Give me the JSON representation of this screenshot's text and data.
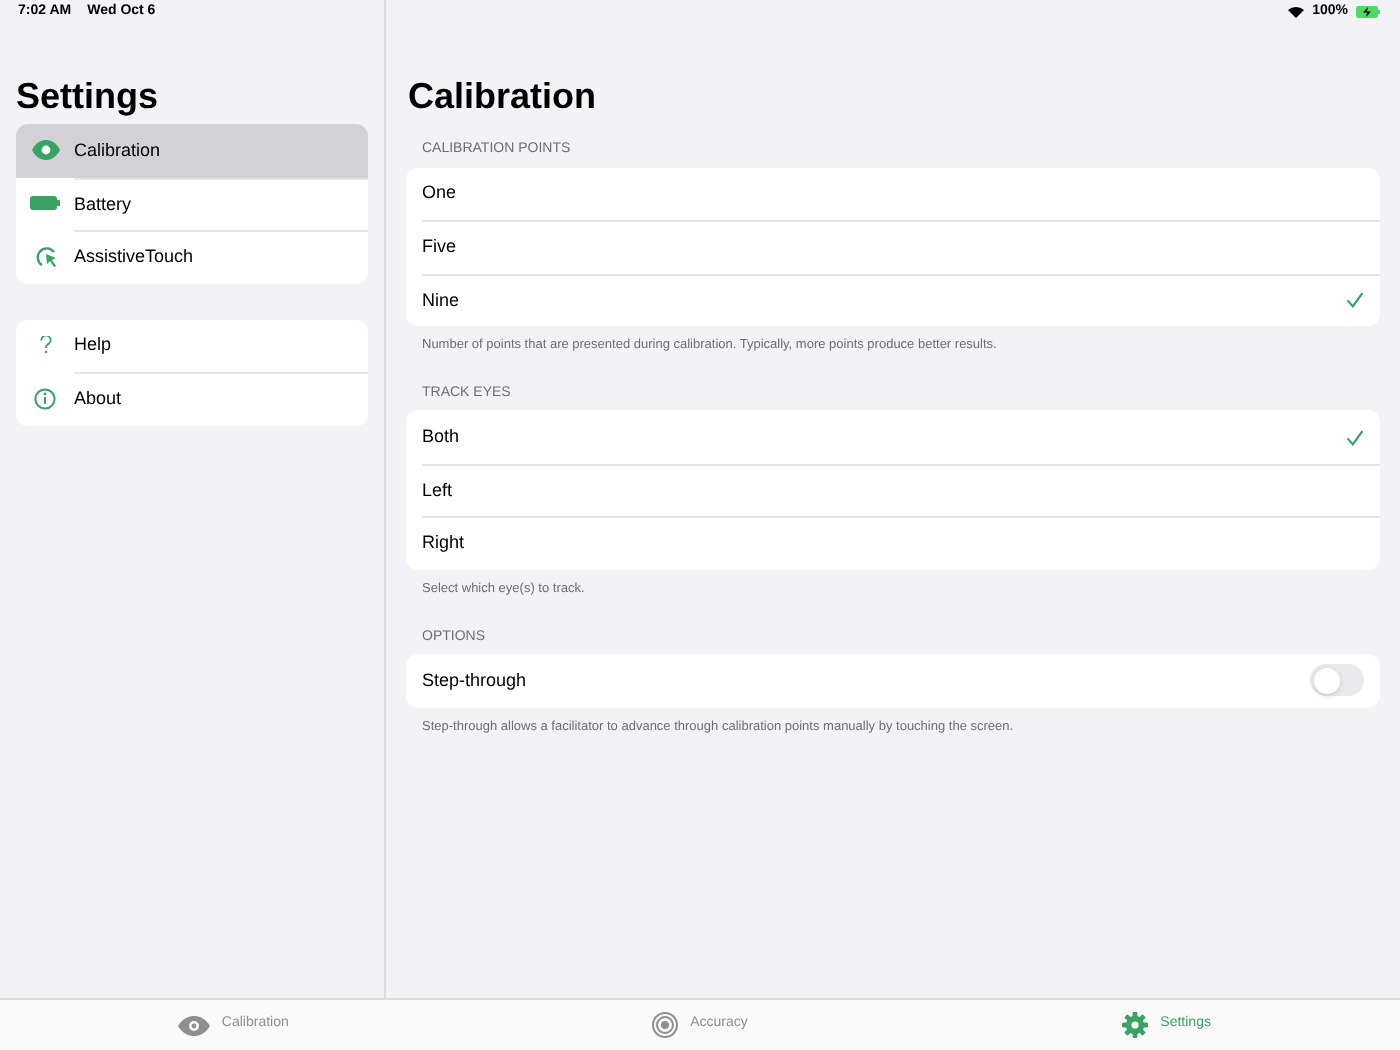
{
  "status_bar": {
    "time": "7:02 AM",
    "date": "Wed Oct 6",
    "battery": "100%"
  },
  "sidebar": {
    "title": "Settings",
    "groups": [
      {
        "items": [
          {
            "label": "Calibration",
            "selected": true
          },
          {
            "label": "Battery",
            "selected": false
          },
          {
            "label": "AssistiveTouch",
            "selected": false
          }
        ]
      },
      {
        "items": [
          {
            "label": "Help",
            "selected": false
          },
          {
            "label": "About",
            "selected": false
          }
        ]
      }
    ]
  },
  "content": {
    "title": "Calibration",
    "sections": [
      {
        "header": "CALIBRATION POINTS",
        "footer": "Number of points that are presented during calibration. Typically, more points produce better results.",
        "rows": [
          {
            "kind": "choice",
            "label": "One",
            "checked": false
          },
          {
            "kind": "choice",
            "label": "Five",
            "checked": false
          },
          {
            "kind": "choice",
            "label": "Nine",
            "checked": true
          }
        ]
      },
      {
        "header": "TRACK EYES",
        "footer": "Select which eye(s) to track.",
        "rows": [
          {
            "kind": "choice",
            "label": "Both",
            "checked": true
          },
          {
            "kind": "choice",
            "label": "Left",
            "checked": false
          },
          {
            "kind": "choice",
            "label": "Right",
            "checked": false
          }
        ]
      },
      {
        "header": "OPTIONS",
        "footer": "Step-through allows a facilitator to advance through calibration points manually by touching the screen.",
        "rows": [
          {
            "kind": "toggle",
            "label": "Step-through",
            "on": false
          }
        ]
      }
    ]
  },
  "tab_bar": [
    {
      "label": "Calibration",
      "selected": false
    },
    {
      "label": "Accuracy",
      "selected": false
    },
    {
      "label": "Settings",
      "selected": true
    }
  ]
}
